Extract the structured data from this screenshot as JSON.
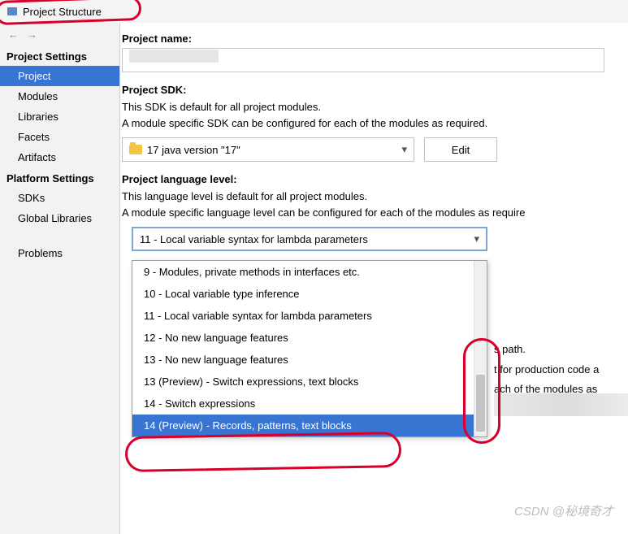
{
  "titlebar": {
    "title": "Project Structure"
  },
  "nav": {
    "back": "←",
    "forward": "→"
  },
  "sidebar": {
    "sections": [
      {
        "header": "Project Settings",
        "items": [
          "Project",
          "Modules",
          "Libraries",
          "Facets",
          "Artifacts"
        ],
        "selected": 0
      },
      {
        "header": "Platform Settings",
        "items": [
          "SDKs",
          "Global Libraries"
        ]
      }
    ],
    "problems": "Problems"
  },
  "main": {
    "projectName": {
      "label": "Project name:",
      "value": ""
    },
    "projectSdk": {
      "label": "Project SDK:",
      "desc1": "This SDK is default for all project modules.",
      "desc2": "A module specific SDK can be configured for each of the modules as required.",
      "selected": "17 java version \"17\"",
      "editBtn": "Edit"
    },
    "langLevel": {
      "label": "Project language level:",
      "desc1": "This language level is default for all project modules.",
      "desc2": "A module specific language level can be configured for each of the modules as require",
      "selected": "11 - Local variable syntax for lambda parameters",
      "options": [
        "9 - Modules, private methods in interfaces etc.",
        "10 - Local variable type inference",
        "11 - Local variable syntax for lambda parameters",
        "12 - No new language features",
        "13 - No new language features",
        "13 (Preview) - Switch expressions, text blocks",
        "14 - Switch expressions",
        "14 (Preview) - Records, patterns, text blocks"
      ],
      "highlighted": 7
    },
    "bgText": {
      "l1": "s path.",
      "l2": "t for production code a",
      "l3": "ach of the modules as"
    }
  },
  "watermark": "CSDN @秘境奇才"
}
